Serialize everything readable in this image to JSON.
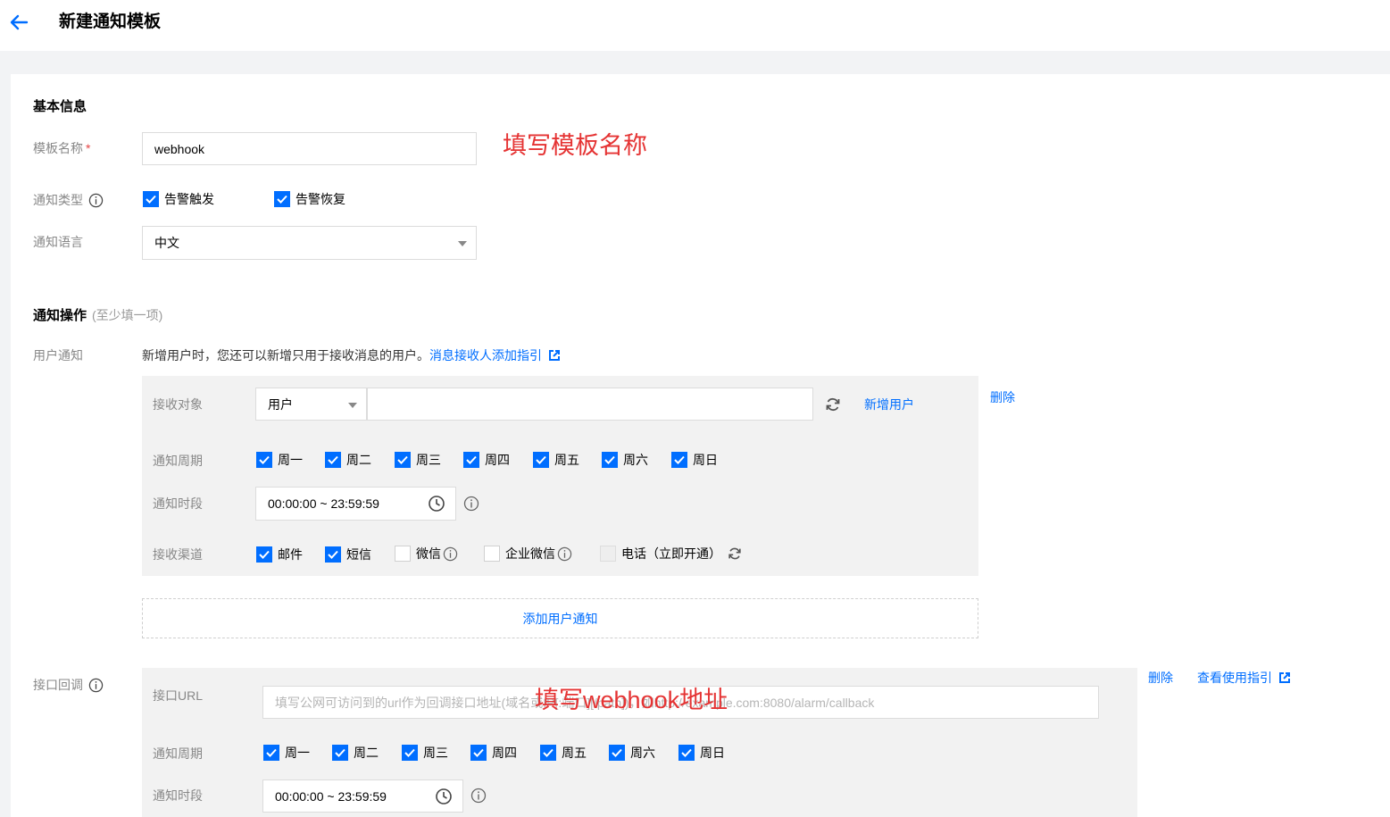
{
  "header": {
    "title": "新建通知模板"
  },
  "basic": {
    "section_title": "基本信息",
    "template_name_label": "模板名称",
    "required_mark": "*",
    "template_name_value": "webhook",
    "annotation_name": "填写模板名称",
    "notify_type_label": "通知类型",
    "notify_types": [
      {
        "label": "告警触发",
        "checked": true
      },
      {
        "label": "告警恢复",
        "checked": true
      }
    ],
    "language_label": "通知语言",
    "language_value": "中文"
  },
  "operations": {
    "section_title": "通知操作",
    "section_hint": "(至少填一项)",
    "user_notify_label": "用户通知",
    "user_notify_desc": "新增用户时，您还可以新增只用于接收消息的用户。",
    "user_notify_guide_link": "消息接收人添加指引",
    "receiver_label": "接收对象",
    "receiver_type": "用户",
    "receiver_value": "",
    "add_user_link": "新增用户",
    "delete_link": "删除",
    "cycle_label": "通知周期",
    "weekdays": [
      "周一",
      "周二",
      "周三",
      "周四",
      "周五",
      "周六",
      "周日"
    ],
    "period_label": "通知时段",
    "period_value": "00:00:00 ~ 23:59:59",
    "channel_label": "接收渠道",
    "channels": [
      {
        "label": "邮件",
        "checked": true
      },
      {
        "label": "短信",
        "checked": true
      },
      {
        "label": "微信",
        "checked": false
      },
      {
        "label": "企业微信",
        "checked": false
      },
      {
        "label": "电话（立即开通）",
        "checked": false
      }
    ],
    "add_user_notify_button": "添加用户通知"
  },
  "callback": {
    "label": "接口回调",
    "delete_link": "删除",
    "guide_link": "查看使用指引",
    "url_label": "接口URL",
    "url_placeholder": "填写公网可访问到的url作为回调接口地址(域名或IP[:端口][/path])，如http://example.com:8080/alarm/callback",
    "annotation_url": "填写webhook地址",
    "cycle_label": "通知周期",
    "weekdays": [
      "周一",
      "周二",
      "周三",
      "周四",
      "周五",
      "周六",
      "周日"
    ],
    "period_label": "通知时段",
    "period_value": "00:00:00 ~ 23:59:59"
  },
  "colors": {
    "accent": "#006eff",
    "annotation": "#e53333",
    "panel": "#f2f2f2"
  }
}
